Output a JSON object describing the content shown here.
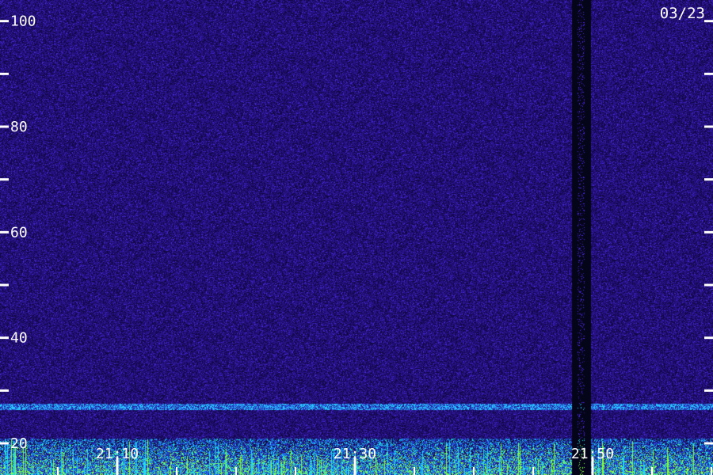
{
  "date_label": "03/23",
  "chart_data": {
    "type": "heatmap",
    "title": "",
    "xlabel": "",
    "ylabel": "",
    "ylim": [
      14,
      104
    ],
    "y_major_ticks": [
      100,
      80,
      60,
      40,
      20
    ],
    "y_major_tick_labels": [
      "100",
      "80",
      "60",
      "40",
      "20"
    ],
    "y_minor_ticks": [
      90,
      70,
      50,
      30
    ],
    "x_tick_labels": [
      "21:10",
      "21:30",
      "21:50"
    ],
    "grid": false,
    "colors": {
      "background": "#2a0f7a",
      "low": "#1a0a4a",
      "mid": "#2a3fd0",
      "high": "#20e0ff",
      "peak": "#7fff40",
      "axis": "#ffffff"
    }
  }
}
